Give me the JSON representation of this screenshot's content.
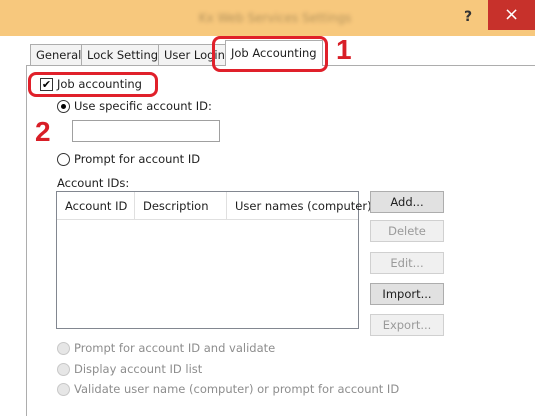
{
  "window": {
    "title": "Kx Web Services Settings",
    "help_label": "?",
    "close_label": "×"
  },
  "tabs": [
    {
      "label": "General"
    },
    {
      "label": "Lock Settings"
    },
    {
      "label": "User Login"
    },
    {
      "label": "Job Accounting"
    }
  ],
  "callouts": {
    "step1": "1",
    "step2": "2"
  },
  "job_accounting": {
    "checkbox_label": "Job accounting",
    "checked": true,
    "use_specific_label": "Use specific account ID:",
    "account_id_value": "",
    "prompt_label": "Prompt for account ID",
    "account_ids_label": "Account IDs:",
    "columns": [
      "Account ID",
      "Description",
      "User names (computer)"
    ],
    "rows": []
  },
  "buttons": {
    "add": "Add...",
    "delete": "Delete",
    "edit": "Edit...",
    "import": "Import...",
    "export": "Export..."
  },
  "options": {
    "prompt_validate": "Prompt for account ID and validate",
    "display_list": "Display account ID list",
    "validate_user": "Validate user name (computer) or prompt for account ID"
  },
  "colors": {
    "title_bar": "#f7c87d",
    "close_button": "#c7312b",
    "highlight": "#e0202a"
  }
}
